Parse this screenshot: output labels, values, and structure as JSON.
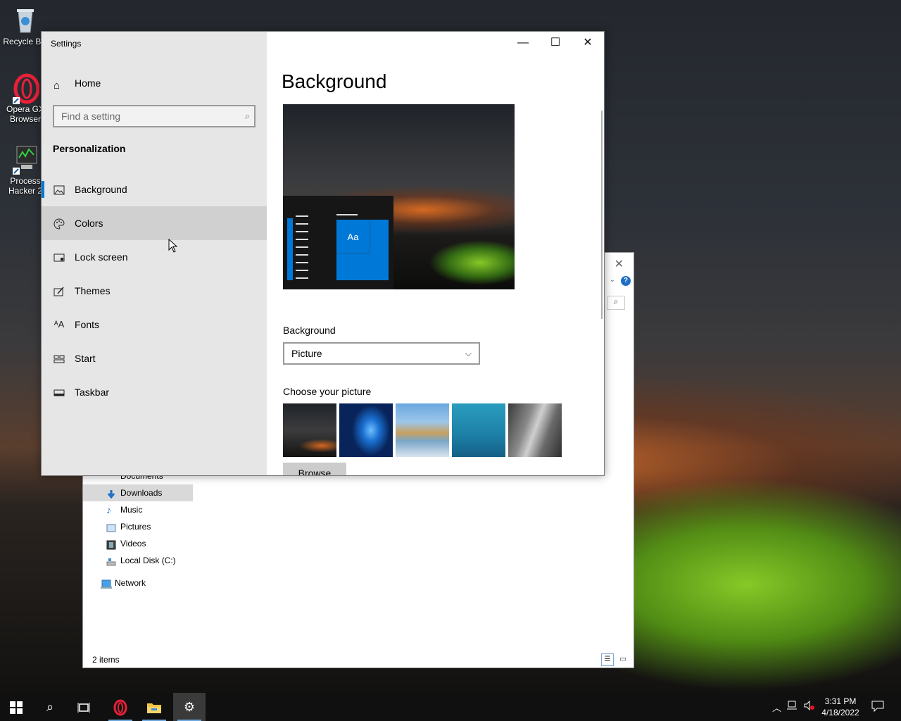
{
  "desktop": {
    "icons": [
      {
        "label": "Recycle Bin"
      },
      {
        "label": "Opera GX Browser"
      },
      {
        "label": "Process Hacker 2"
      }
    ]
  },
  "explorer": {
    "nav": [
      {
        "label": "Documents"
      },
      {
        "label": "Downloads"
      },
      {
        "label": "Music"
      },
      {
        "label": "Pictures"
      },
      {
        "label": "Videos"
      },
      {
        "label": "Local Disk (C:)"
      },
      {
        "label": "Network"
      }
    ],
    "status": "2 items"
  },
  "settings": {
    "window_title": "Settings",
    "home_label": "Home",
    "search_placeholder": "Find a setting",
    "section_title": "Personalization",
    "menu": [
      {
        "label": "Background",
        "icon": "picture-icon"
      },
      {
        "label": "Colors",
        "icon": "palette-icon"
      },
      {
        "label": "Lock screen",
        "icon": "lock-screen-icon"
      },
      {
        "label": "Themes",
        "icon": "brush-icon"
      },
      {
        "label": "Fonts",
        "icon": "font-icon"
      },
      {
        "label": "Start",
        "icon": "start-icon"
      },
      {
        "label": "Taskbar",
        "icon": "taskbar-icon"
      }
    ],
    "content": {
      "title": "Background",
      "preview_tile_text": "Aa",
      "background_label": "Background",
      "background_value": "Picture",
      "choose_label": "Choose your picture",
      "browse_label": "Browse"
    }
  },
  "taskbar": {
    "time": "3:31 PM",
    "date": "4/18/2022"
  },
  "colors": {
    "accent": "#0078d7",
    "sidebar_bg": "#e6e6e6",
    "taskbar_bg": "#101010"
  }
}
